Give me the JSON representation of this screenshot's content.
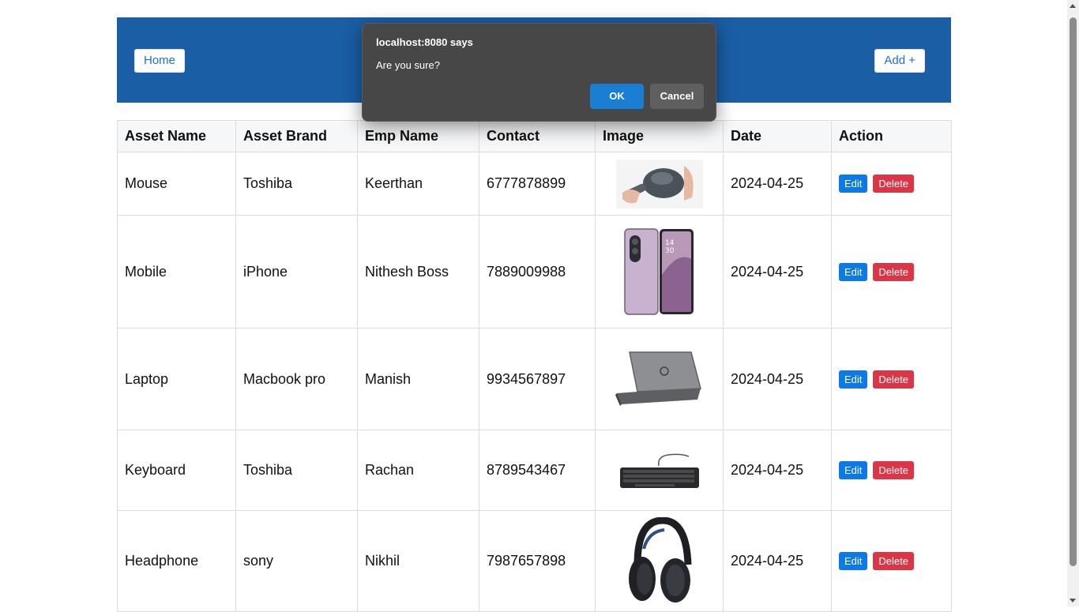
{
  "header": {
    "home_label": "Home",
    "add_label": "Add +"
  },
  "table": {
    "columns": [
      "Asset Name",
      "Asset Brand",
      "Emp Name",
      "Contact",
      "Image",
      "Date",
      "Action"
    ],
    "rows": [
      {
        "asset": "Mouse",
        "brand": "Toshiba",
        "emp": "Keerthan",
        "contact": "6777878899",
        "image_icon": "mouse-photo",
        "date": "2024-04-25",
        "edit": "Edit",
        "delete": "Delete"
      },
      {
        "asset": "Mobile",
        "brand": "iPhone",
        "emp": "Nithesh Boss",
        "contact": "7889009988",
        "image_icon": "phone-photo",
        "date": "2024-04-25",
        "edit": "Edit",
        "delete": "Delete"
      },
      {
        "asset": "Laptop",
        "brand": "Macbook pro",
        "emp": "Manish",
        "contact": "9934567897",
        "image_icon": "laptop-photo",
        "date": "2024-04-25",
        "edit": "Edit",
        "delete": "Delete"
      },
      {
        "asset": "Keyboard",
        "brand": "Toshiba",
        "emp": "Rachan",
        "contact": "8789543467",
        "image_icon": "keyboard-photo",
        "date": "2024-04-25",
        "edit": "Edit",
        "delete": "Delete"
      },
      {
        "asset": "Headphone",
        "brand": "sony",
        "emp": "Nikhil",
        "contact": "7987657898",
        "image_icon": "headphone-photo",
        "date": "2024-04-25",
        "edit": "Edit",
        "delete": "Delete"
      }
    ]
  },
  "dialog": {
    "title": "localhost:8080 says",
    "message": "Are you sure?",
    "ok_label": "OK",
    "cancel_label": "Cancel"
  },
  "colors": {
    "header_bg": "#1a5ea6",
    "edit_btn": "#0b79e8",
    "delete_btn": "#dc3545",
    "dialog_bg": "#474747",
    "ok_btn": "#1a7ed3"
  }
}
